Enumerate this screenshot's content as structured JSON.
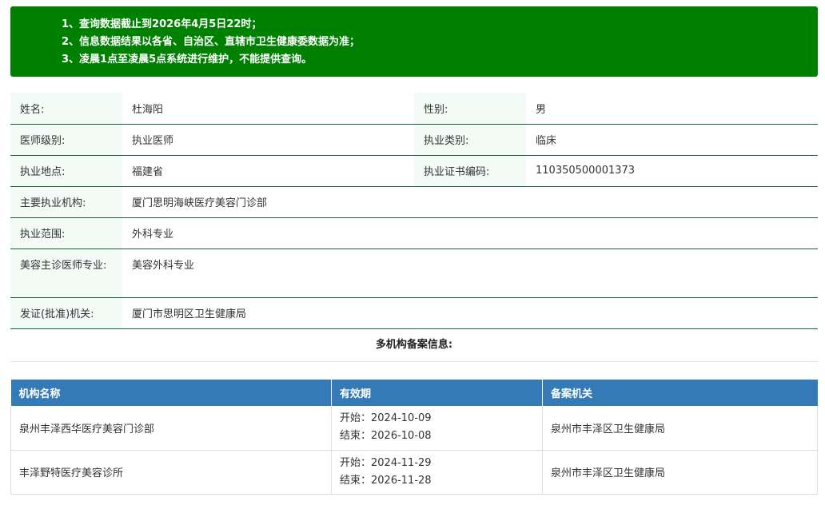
{
  "notice": {
    "lines": [
      "1、查询数据截止到2026年4月5日22时；",
      "2、信息数据结果以各省、自治区、直辖市卫生健康委数据为准；",
      "3、凌晨1点至凌晨5点系统进行维护，不能提供查询。"
    ]
  },
  "info": {
    "name_label": "姓名:",
    "name_value": "杜海阳",
    "gender_label": "性别:",
    "gender_value": "男",
    "level_label": "医师级别:",
    "level_value": "执业医师",
    "category_label": "执业类别:",
    "category_value": "临床",
    "location_label": "执业地点:",
    "location_value": "福建省",
    "cert_label": "执业证书编码:",
    "cert_value": "110350500001373",
    "org_label": "主要执业机构:",
    "org_value": "厦门思明海峡医疗美容门诊部",
    "scope_label": "执业范围:",
    "scope_value": "外科专业",
    "cosmetic_label": "美容主诊医师专业:",
    "cosmetic_value": "美容外科专业",
    "issuer_label": "发证(批准)机关:",
    "issuer_value": "厦门市思明区卫生健康局"
  },
  "multi_title": "多机构备案信息:",
  "records": {
    "headers": [
      "机构名称",
      "有效期",
      "备案机关"
    ],
    "rows": [
      {
        "org": "泉州丰泽西华医疗美容门诊部",
        "start": "开始：2024-10-09",
        "end": "结束：2026-10-08",
        "authority": "泉州市丰泽区卫生健康局"
      },
      {
        "org": "丰泽野特医疗美容诊所",
        "start": "开始：2024-11-29",
        "end": "结束：2026-11-28",
        "authority": "泉州市丰泽区卫生健康局"
      }
    ]
  },
  "colors": {
    "notice_bg": "#008000",
    "label_bg": "#f2fbf6",
    "row_border": "#1a5e45",
    "header_bg": "#337ab7"
  }
}
